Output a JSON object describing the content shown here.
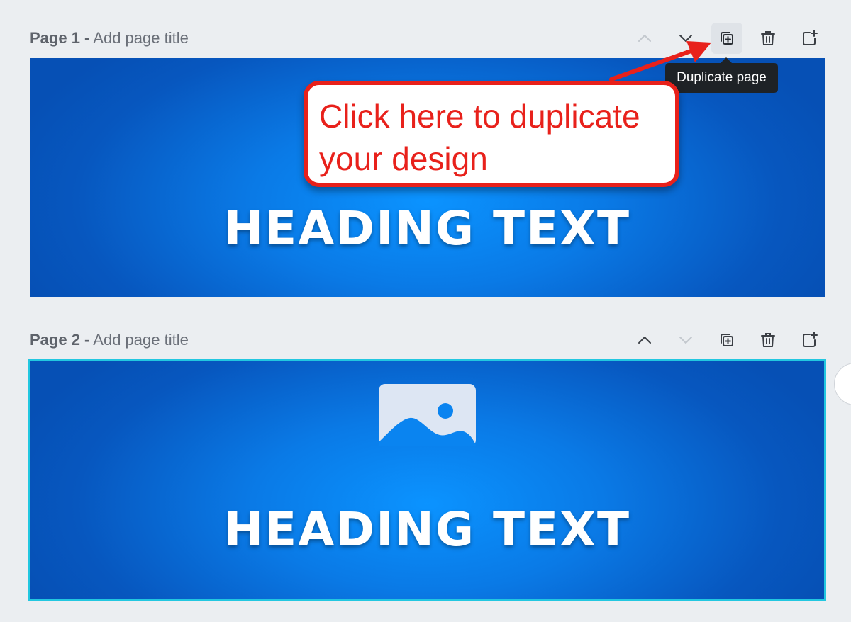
{
  "pages": [
    {
      "number_label": "Page 1 -",
      "title_placeholder": "Add page title",
      "heading": "HEADING TEXT",
      "tools": {
        "move_up": "chevron-up-icon",
        "move_down": "chevron-down-icon",
        "duplicate": "duplicate-page-icon",
        "delete": "trash-icon",
        "add": "add-page-icon"
      }
    },
    {
      "number_label": "Page 2 -",
      "title_placeholder": "Add page title",
      "heading": "HEADING TEXT",
      "selected": true,
      "tools": {
        "move_up": "chevron-up-icon",
        "move_down": "chevron-down-icon",
        "duplicate": "duplicate-page-icon",
        "delete": "trash-icon",
        "add": "add-page-icon"
      }
    }
  ],
  "tooltip": {
    "text": "Duplicate page"
  },
  "callout": {
    "line1": "Click here to duplicate",
    "line2": "your design"
  },
  "colors": {
    "canvas_blue": "#0a7ae6",
    "selection_outline": "#22c7e0",
    "callout_red": "#e8211b",
    "tooltip_bg": "#1e2226"
  }
}
